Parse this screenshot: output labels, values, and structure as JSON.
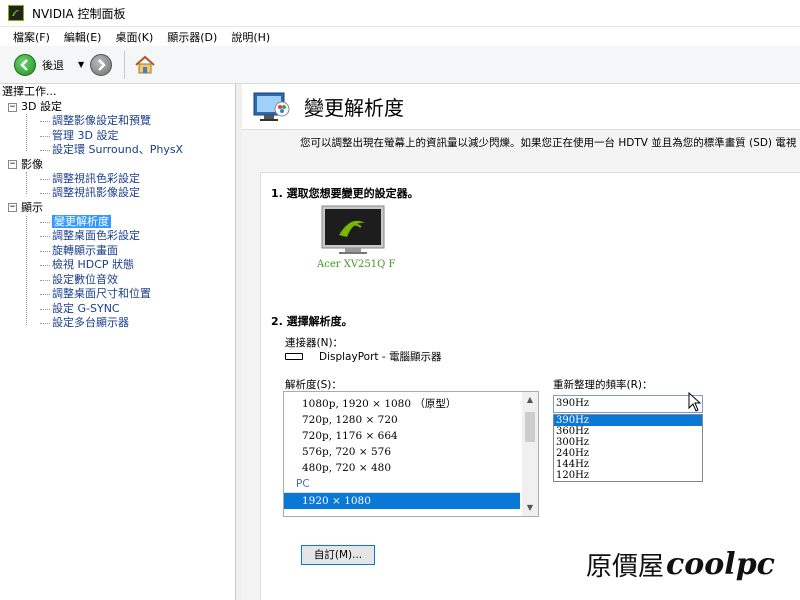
{
  "window": {
    "title": "NVIDIA 控制面板"
  },
  "menu": [
    "檔案(F)",
    "編輯(E)",
    "桌面(K)",
    "顯示器(D)",
    "說明(H)"
  ],
  "toolbar": {
    "back_label": "後退"
  },
  "left": {
    "header": "選擇工作...",
    "categories": [
      {
        "label": "3D 設定",
        "items": [
          "調整影像設定和預覽",
          "管理 3D 設定",
          "設定環 Surround、PhysX"
        ]
      },
      {
        "label": "影像",
        "items": [
          "調整視訊色彩設定",
          "調整視訊影像設定"
        ]
      },
      {
        "label": "顯示",
        "items": [
          "變更解析度",
          "調整桌面色彩設定",
          "旋轉顯示畫面",
          "檢視 HDCP 狀態",
          "設定數位音效",
          "調整桌面尺寸和位置",
          "設定 G-SYNC",
          "設定多台顯示器"
        ]
      }
    ],
    "selected": "變更解析度"
  },
  "main": {
    "title": "變更解析度",
    "description": "您可以調整出現在螢幕上的資訊量以減少閃爍。如果您正在使用一台 HDTV 並且為您的標準畫質 (SD) 電視",
    "step1": "1. 選取您想要變更的設定器。",
    "monitor_name": "Acer XV251Q F",
    "step2": "2. 選擇解析度。",
    "connector_label": "連接器(N)：",
    "connector_value": "DisplayPort - 電腦顯示器",
    "resolution_label": "解析度(S)：",
    "resolutions": [
      "1080p, 1920 × 1080 （原型）",
      "720p, 1280 × 720",
      "720p, 1176 × 664",
      "576p, 720 × 576",
      "480p, 720 × 480"
    ],
    "pc_group": "PC",
    "pc_selected": "1920 × 1080",
    "refresh_label": "重新整理的頻率(R)：",
    "refresh_value": "390Hz",
    "refresh_options": [
      "390Hz",
      "360Hz",
      "300Hz",
      "240Hz",
      "144Hz",
      "120Hz"
    ],
    "custom_button": "自訂(M)..."
  },
  "watermark": {
    "text": "原價屋",
    "brand": "coolpc"
  },
  "colors": {
    "nvidia_green": "#76b900",
    "selection_blue": "#0a78d7"
  }
}
